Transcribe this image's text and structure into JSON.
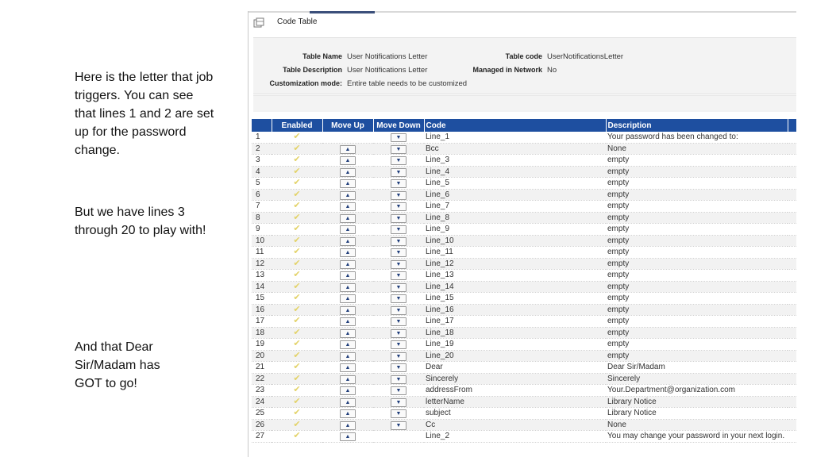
{
  "notes": [
    "Here is the letter that job triggers.  You can see that lines 1 and 2 are set up for the password change.",
    "But we have lines 3 through 20 to play with!",
    "And that Dear Sir/Madam has GOT to go!"
  ],
  "window": {
    "title": "Code Table"
  },
  "properties": {
    "table_name_label": "Table Name",
    "table_name": "User Notifications Letter",
    "table_description_label": "Table Description",
    "table_description": "User Notifications Letter",
    "customization_mode_label": "Customization mode:",
    "customization_mode": "Entire table needs to be customized",
    "table_code_label": "Table code",
    "table_code": "UserNotificationsLetter",
    "managed_label": "Managed in Network",
    "managed": "No"
  },
  "table": {
    "headers": [
      "",
      "Enabled",
      "Move Up",
      "Move Down",
      "Code",
      "Description"
    ],
    "rows": [
      {
        "n": "1",
        "code": "Line_1",
        "desc": "Your password has been changed to:"
      },
      {
        "n": "2",
        "code": "Bcc",
        "desc": "None"
      },
      {
        "n": "3",
        "code": "Line_3",
        "desc": "empty"
      },
      {
        "n": "4",
        "code": "Line_4",
        "desc": "empty"
      },
      {
        "n": "5",
        "code": "Line_5",
        "desc": "empty"
      },
      {
        "n": "6",
        "code": "Line_6",
        "desc": "empty"
      },
      {
        "n": "7",
        "code": "Line_7",
        "desc": "empty"
      },
      {
        "n": "8",
        "code": "Line_8",
        "desc": "empty"
      },
      {
        "n": "9",
        "code": "Line_9",
        "desc": "empty"
      },
      {
        "n": "10",
        "code": "Line_10",
        "desc": "empty"
      },
      {
        "n": "11",
        "code": "Line_11",
        "desc": "empty"
      },
      {
        "n": "12",
        "code": "Line_12",
        "desc": "empty"
      },
      {
        "n": "13",
        "code": "Line_13",
        "desc": "empty"
      },
      {
        "n": "14",
        "code": "Line_14",
        "desc": "empty"
      },
      {
        "n": "15",
        "code": "Line_15",
        "desc": "empty"
      },
      {
        "n": "16",
        "code": "Line_16",
        "desc": "empty"
      },
      {
        "n": "17",
        "code": "Line_17",
        "desc": "empty"
      },
      {
        "n": "18",
        "code": "Line_18",
        "desc": "empty"
      },
      {
        "n": "19",
        "code": "Line_19",
        "desc": "empty"
      },
      {
        "n": "20",
        "code": "Line_20",
        "desc": "empty"
      },
      {
        "n": "21",
        "code": "Dear",
        "desc": "Dear Sir/Madam"
      },
      {
        "n": "22",
        "code": "Sincerely",
        "desc": "Sincerely"
      },
      {
        "n": "23",
        "code": "addressFrom",
        "desc": "Your.Department@organization.com"
      },
      {
        "n": "24",
        "code": "letterName",
        "desc": "Library Notice"
      },
      {
        "n": "25",
        "code": "subject",
        "desc": "Library Notice"
      },
      {
        "n": "26",
        "code": "Cc",
        "desc": "None"
      },
      {
        "n": "27",
        "code": "Line_2",
        "desc": "You may change your password in your next login."
      }
    ]
  },
  "icons": {
    "enabled": "checkmark-icon",
    "up": "arrow-up-icon",
    "down": "arrow-down-icon",
    "title": "table-icon"
  },
  "colors": {
    "header": "#1e4fa0",
    "checkmark": "#e3d36a"
  }
}
